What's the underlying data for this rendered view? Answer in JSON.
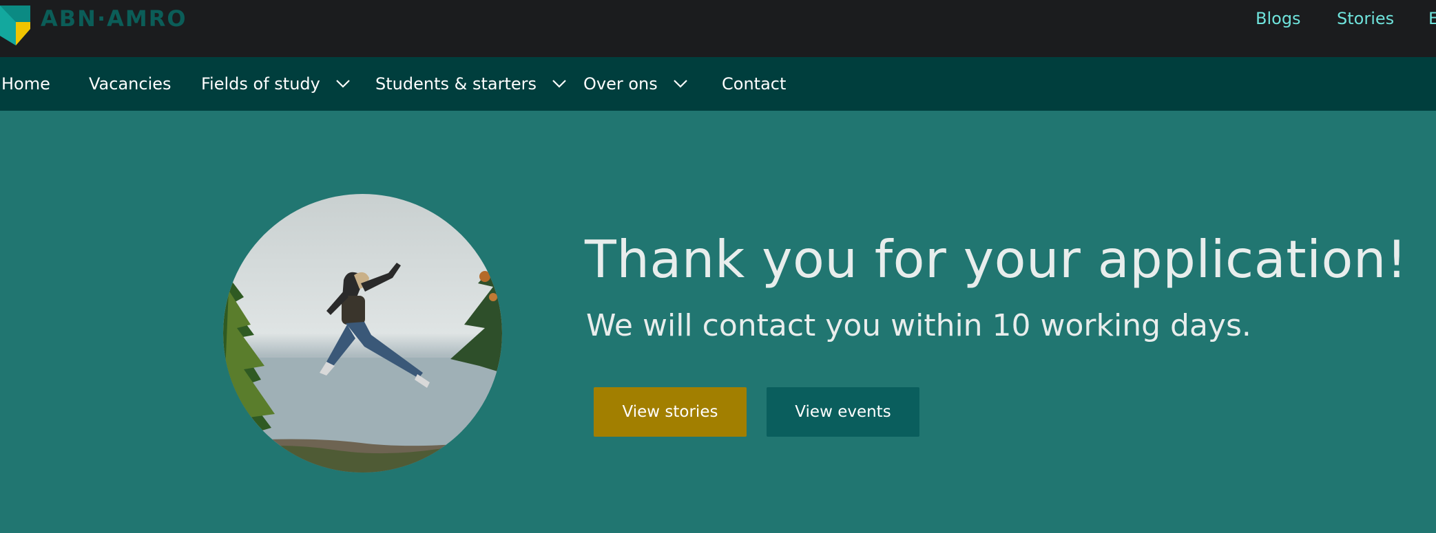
{
  "header": {
    "logo_text": "ABN·AMRO",
    "top_links": [
      "Blogs",
      "Stories",
      "E"
    ]
  },
  "nav": {
    "items": [
      {
        "label": "Home",
        "dropdown": false
      },
      {
        "label": "Vacancies",
        "dropdown": false
      },
      {
        "label": "Fields of study",
        "dropdown": true
      },
      {
        "label": "Students & starters",
        "dropdown": true
      },
      {
        "label": "Over ons",
        "dropdown": true
      },
      {
        "label": "Contact",
        "dropdown": false
      }
    ]
  },
  "hero": {
    "title": "Thank you for your application!",
    "subtitle": "We will contact you within 10 working days.",
    "buttons": {
      "stories": "View stories",
      "events": "View events"
    }
  },
  "colors": {
    "topbar": "#1b1c1e",
    "nav": "#003e3d",
    "hero_bg": "#217671",
    "top_link": "#6fe3dc",
    "btn_stories": "#a27f00",
    "btn_events": "#0a5e5d",
    "logo_green": "#0b8a83",
    "logo_yellow": "#f1c400"
  }
}
